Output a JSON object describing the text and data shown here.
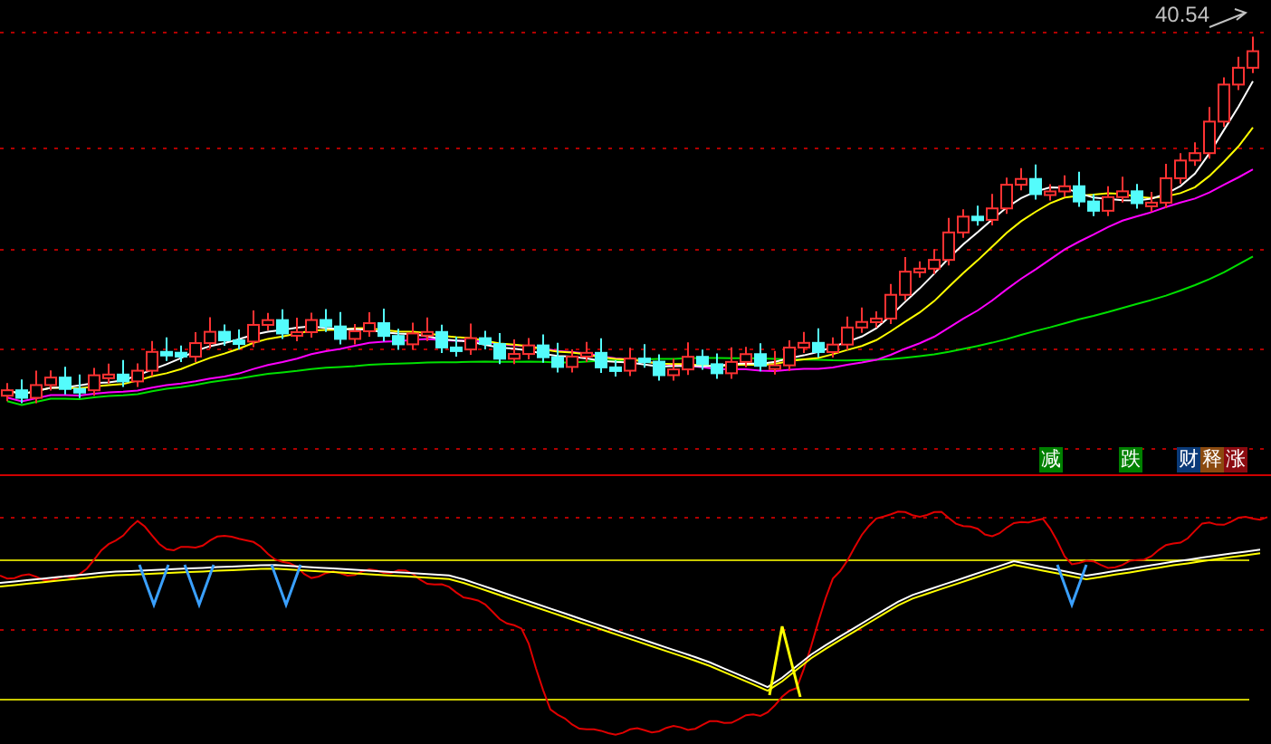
{
  "price_label": {
    "text": "40.54"
  },
  "signal_tags": [
    {
      "text": "减",
      "color": "#008000"
    },
    {
      "text": "跌",
      "color": "#008000"
    },
    {
      "text": "财",
      "color": "#0a3a78"
    },
    {
      "text": "释",
      "color": "#8b4a10"
    },
    {
      "text": "涨",
      "color": "#8b0a10"
    }
  ]
}
